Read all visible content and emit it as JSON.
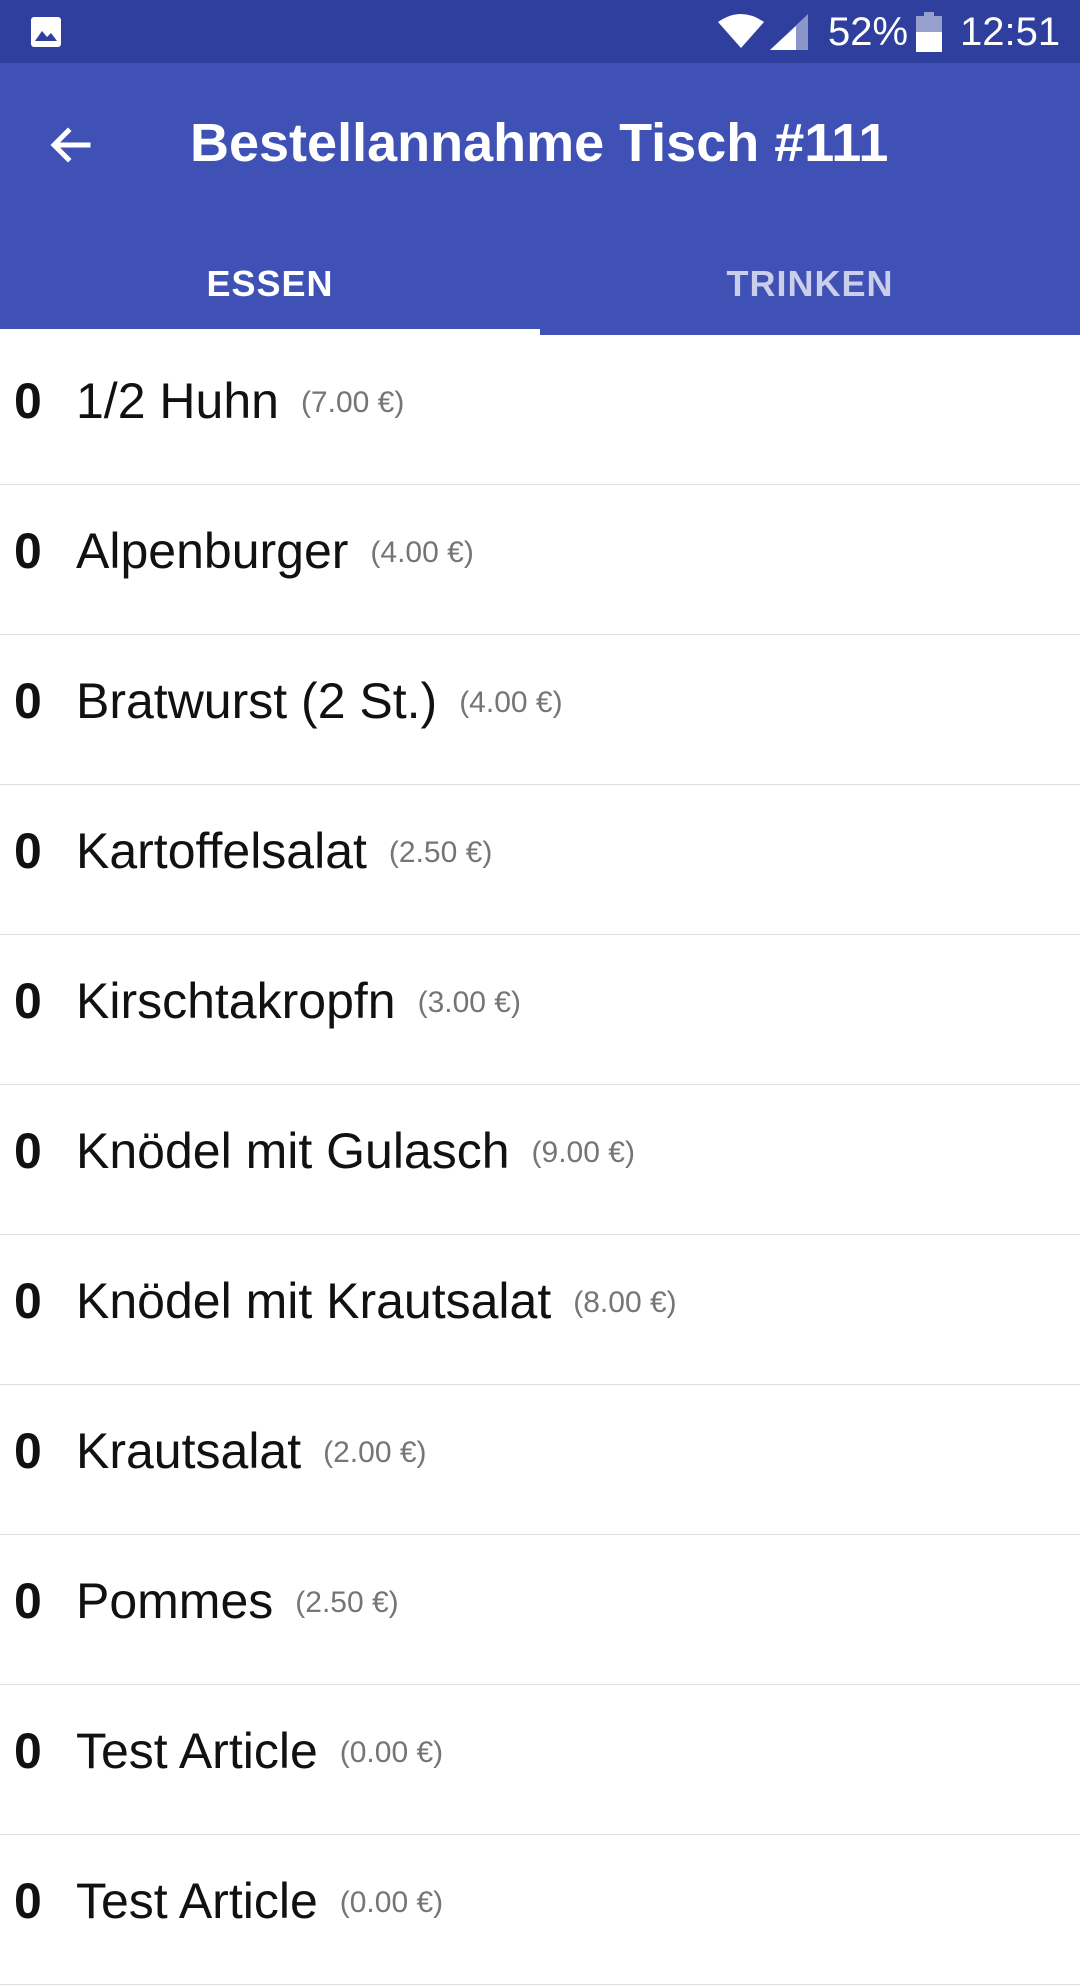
{
  "status_bar": {
    "battery": "52%",
    "time": "12:51",
    "icons": [
      "gallery-icon",
      "wifi-icon",
      "signal-icon",
      "battery-icon"
    ]
  },
  "app_bar": {
    "title": "Bestellannahme Tisch #111",
    "back_icon": "arrow-back-icon"
  },
  "tabs": [
    {
      "label": "ESSEN",
      "selected": true
    },
    {
      "label": "TRINKEN",
      "selected": false
    }
  ],
  "colors": {
    "status_bar": "#2f3f9e",
    "primary": "#3f51b5",
    "text": "#111111",
    "price": "#757575",
    "divider": "#dedede"
  },
  "items": [
    {
      "qty": "0",
      "name": "1/2 Huhn",
      "price": "(7.00 €)"
    },
    {
      "qty": "0",
      "name": "Alpenburger",
      "price": "(4.00 €)"
    },
    {
      "qty": "0",
      "name": "Bratwurst (2 St.)",
      "price": "(4.00 €)"
    },
    {
      "qty": "0",
      "name": "Kartoffelsalat",
      "price": "(2.50 €)"
    },
    {
      "qty": "0",
      "name": "Kirschtakropfn",
      "price": "(3.00 €)"
    },
    {
      "qty": "0",
      "name": "Knödel mit Gulasch",
      "price": "(9.00 €)"
    },
    {
      "qty": "0",
      "name": "Knödel mit Krautsalat",
      "price": "(8.00 €)"
    },
    {
      "qty": "0",
      "name": "Krautsalat",
      "price": "(2.00 €)"
    },
    {
      "qty": "0",
      "name": "Pommes",
      "price": "(2.50 €)"
    },
    {
      "qty": "0",
      "name": "Test Article",
      "price": "(0.00 €)"
    },
    {
      "qty": "0",
      "name": "Test Article",
      "price": "(0.00 €)"
    }
  ]
}
